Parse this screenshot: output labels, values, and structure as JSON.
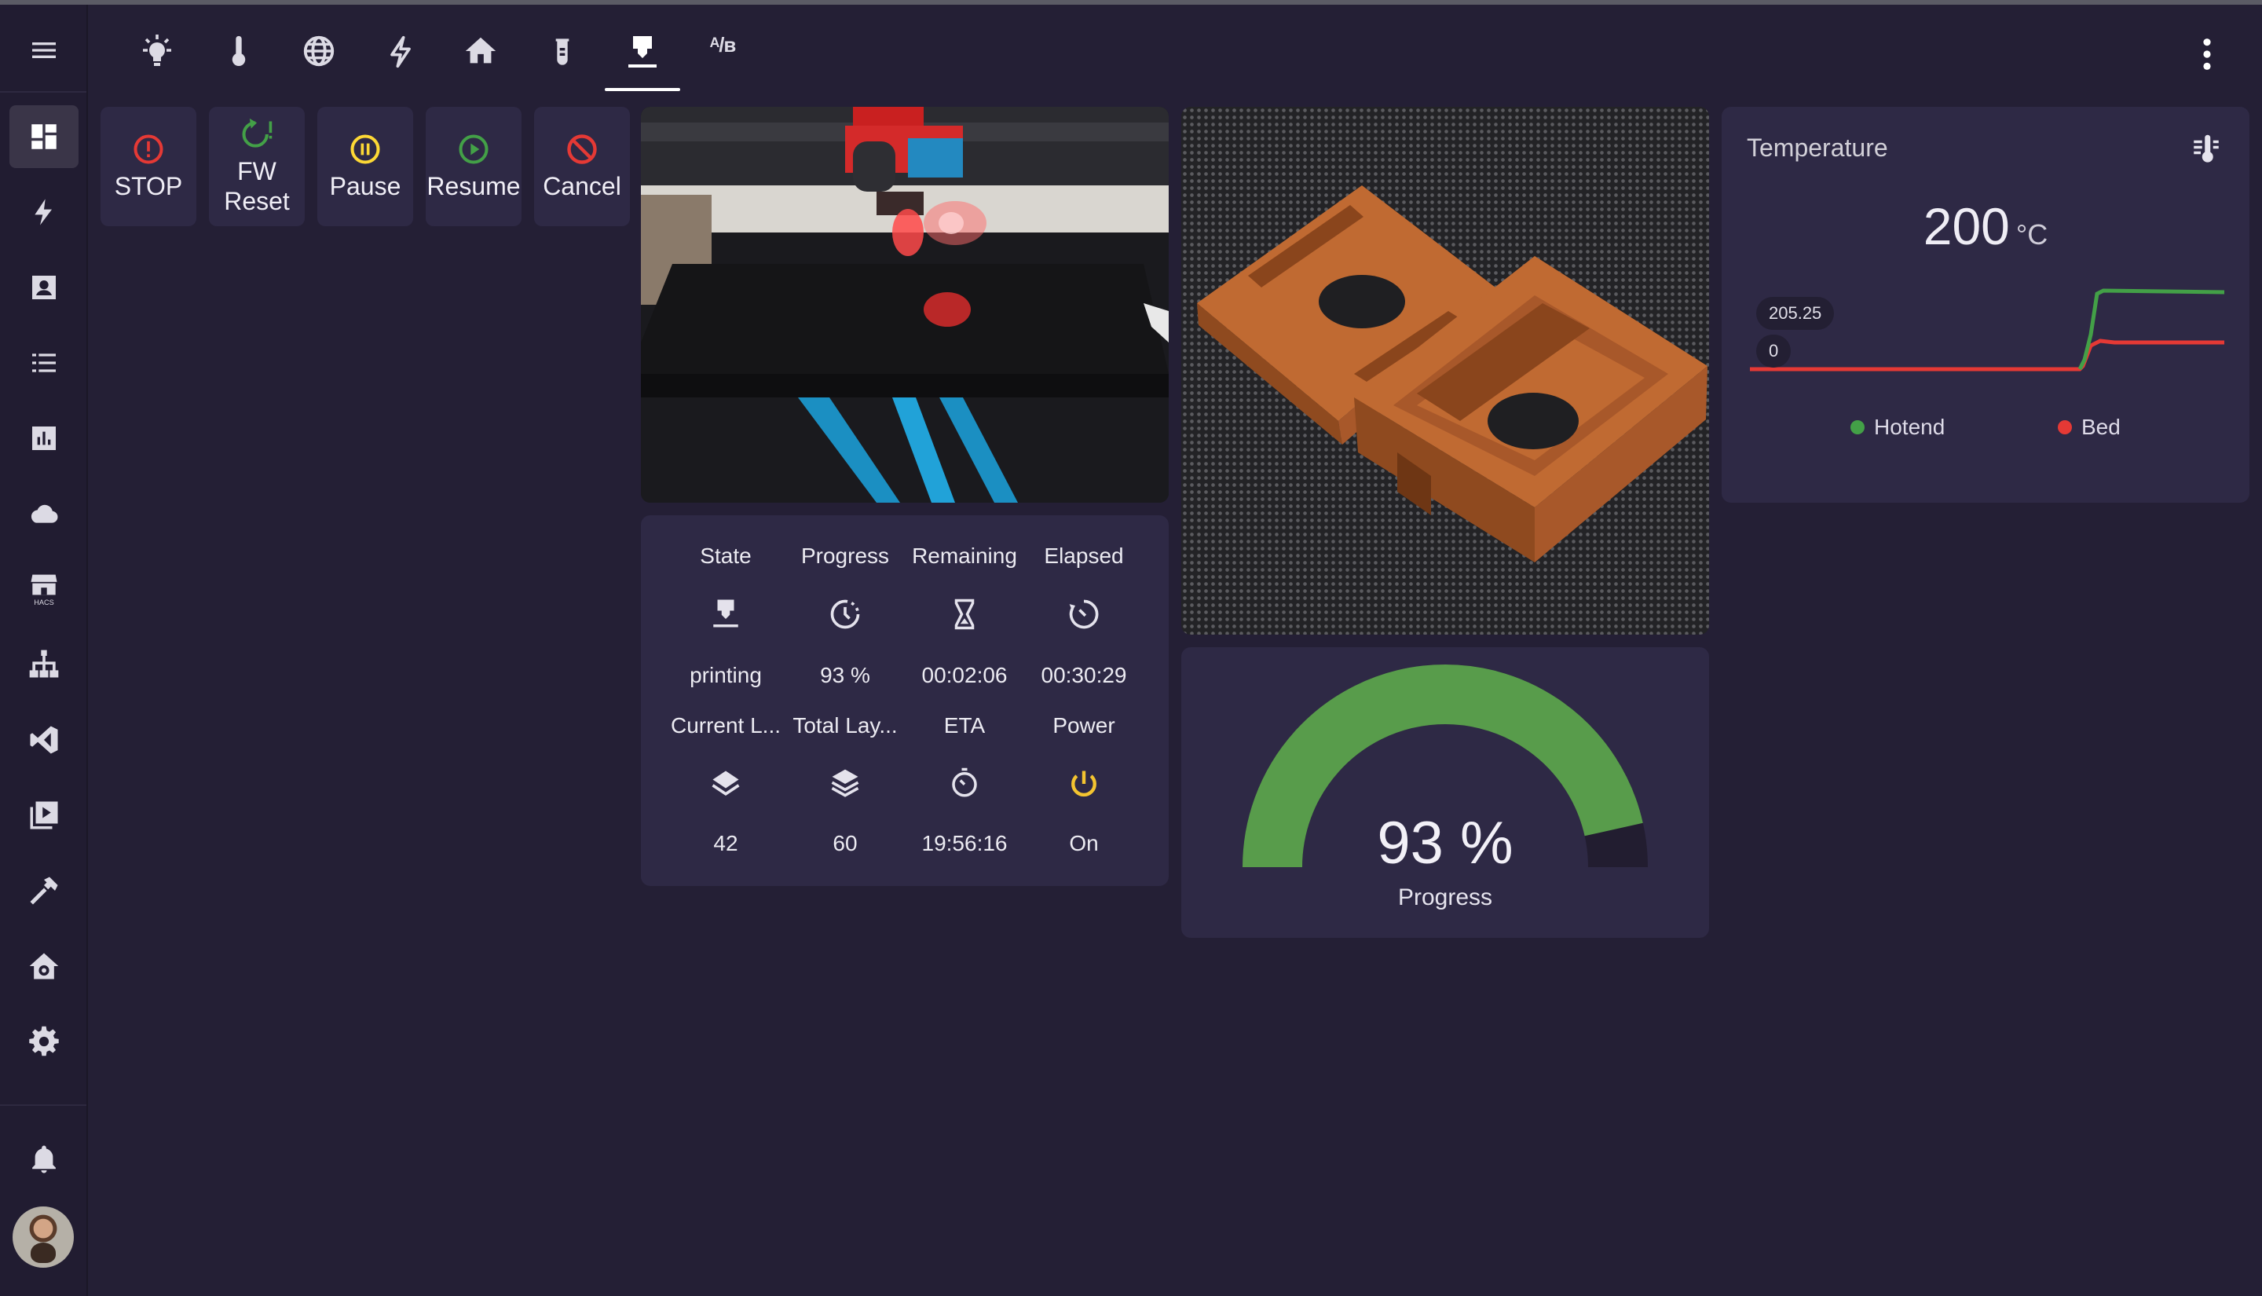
{
  "controls": [
    {
      "label": "STOP",
      "icon": "alert-circle-icon",
      "color": "#e53935"
    },
    {
      "label": "FW\nReset",
      "icon": "restart-alert-icon",
      "color": "#43a047"
    },
    {
      "label": "Pause",
      "icon": "pause-circle-icon",
      "color": "#fdd835"
    },
    {
      "label": "Resume",
      "icon": "play-circle-icon",
      "color": "#43a047"
    },
    {
      "label": "Cancel",
      "icon": "cancel-icon",
      "color": "#e53935"
    }
  ],
  "temperature": {
    "title": "Temperature",
    "value": "200",
    "unit": "°C",
    "y_max_label": "205.25",
    "y_min_label": "0",
    "legend": [
      {
        "name": "Hotend",
        "color": "#43a047"
      },
      {
        "name": "Bed",
        "color": "#e53935"
      }
    ]
  },
  "stats": {
    "row1_labels": [
      "State",
      "Progress",
      "Remaining",
      "Elapsed"
    ],
    "row1_values": [
      "printing",
      "93 %",
      "00:02:06",
      "00:30:29"
    ],
    "row2_labels": [
      "Current L...",
      "Total Lay...",
      "ETA",
      "Power"
    ],
    "row2_values": [
      "42",
      "60",
      "19:56:16",
      "On"
    ]
  },
  "gauge": {
    "value": "93 %",
    "label": "Progress",
    "fraction": 0.93
  },
  "colors": {
    "background": "#241f35",
    "card": "#2e2945",
    "gauge_fill": "#589c4b",
    "power_on": "#f4c430"
  }
}
